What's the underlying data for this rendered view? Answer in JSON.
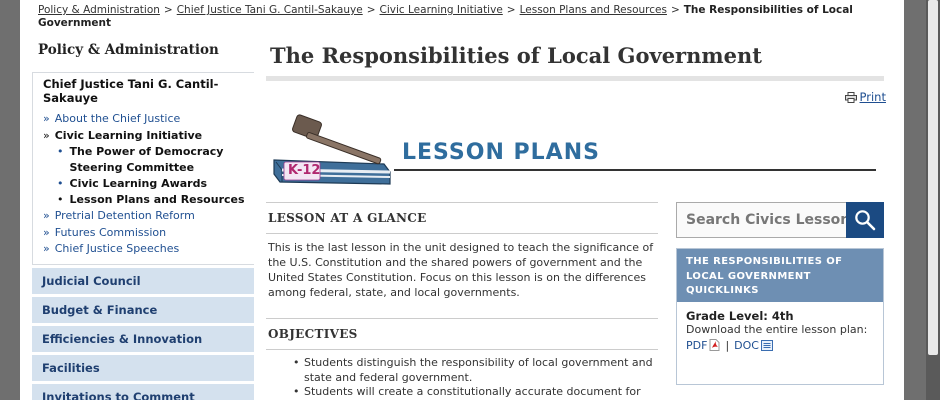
{
  "breadcrumb": {
    "items": [
      "Policy & Administration",
      "Chief Justice Tani G. Cantil-Sakauye",
      "Civic Learning Initiative",
      "Lesson Plans and Resources"
    ],
    "separator": ">",
    "current": "The Responsibilities of Local Government"
  },
  "sidebar": {
    "heading": "Policy & Administration",
    "box_title": "Chief Justice Tani G. Cantil-Sakauye",
    "raquo": "»",
    "bullet": "•",
    "items": [
      {
        "label": "About the Chief Justice"
      },
      {
        "label": "Civic Learning Initiative"
      },
      {
        "label": "Pretrial Detention Reform"
      },
      {
        "label": "Futures Commission"
      },
      {
        "label": "Chief Justice Speeches"
      }
    ],
    "subitems": [
      {
        "label": "The Power of Democracy Steering Committee"
      },
      {
        "label": "Civic Learning Awards"
      },
      {
        "label": "Lesson Plans and Resources"
      }
    ],
    "categories": [
      "Judicial Council",
      "Budget & Finance",
      "Efficiencies & Innovation",
      "Facilities",
      "Invitations to Comment"
    ]
  },
  "main": {
    "title": "The Responsibilities of Local Government",
    "print_label": "Print",
    "banner": {
      "text": "LESSON PLANS",
      "book_label": "K-12"
    },
    "glance": {
      "title": "LESSON AT A GLANCE",
      "body": "This is the last lesson in the unit designed to teach the significance of the U.S. Constitution and the shared powers of government and the United States Constitution.  Focus on this lesson is on the differences among federal, state, and local governments."
    },
    "objectives": {
      "title": "OBJECTIVES",
      "items": [
        "Students distinguish the responsibility of local government and state and federal government.",
        "Students will create a constitutionally accurate document for"
      ]
    }
  },
  "search": {
    "placeholder": "Search Civics Lessons"
  },
  "quicklinks": {
    "title": "THE RESPONSIBILITIES OF LOCAL GOVERNMENT QUICKLINKS",
    "grade": "Grade Level: 4th",
    "download_text": "Download the entire lesson plan:",
    "pdf_label": "PDF",
    "doc_label": "DOC",
    "link_separator": "|"
  },
  "colors": {
    "link": "#1f4f91",
    "nav_category_bg": "#d4e1ee",
    "quicklinks_header_bg": "#6e8fb3",
    "search_button_bg": "#1b4a82",
    "banner_text": "#2f6d9e"
  }
}
